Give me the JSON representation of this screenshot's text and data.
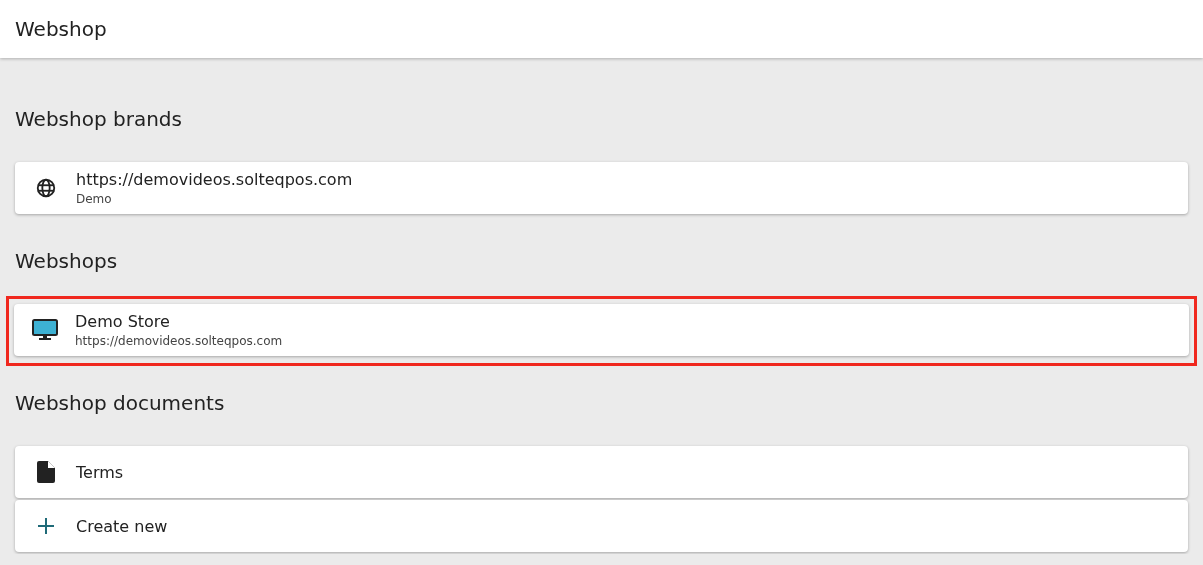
{
  "header": {
    "title": "Webshop"
  },
  "sections": [
    {
      "title": "Webshop brands",
      "items": [
        {
          "kind": "globe",
          "title": "https://demovideos.solteqpos.com",
          "subtitle": "Demo",
          "highlighted": false
        }
      ]
    },
    {
      "title": "Webshops",
      "items": [
        {
          "kind": "monitor",
          "title": "Demo Store",
          "subtitle": "https://demovideos.solteqpos.com",
          "highlighted": true
        }
      ]
    },
    {
      "title": "Webshop documents",
      "items": [
        {
          "kind": "document",
          "title": "Terms",
          "highlighted": false
        },
        {
          "kind": "add",
          "title": "Create new",
          "highlighted": false
        }
      ]
    }
  ]
}
